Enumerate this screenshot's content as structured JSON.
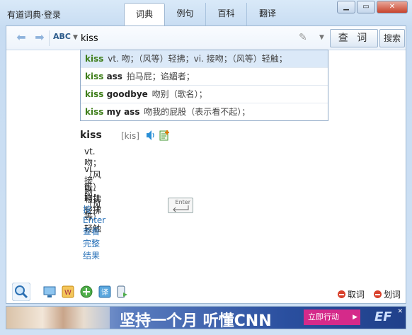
{
  "window": {
    "app_name": "有道词典",
    "separator": "·",
    "login_label": "登录",
    "minimize": "▁",
    "restore": "▭",
    "close": "✕"
  },
  "tabs": [
    {
      "label": "词典",
      "active": true
    },
    {
      "label": "例句",
      "active": false
    },
    {
      "label": "百科",
      "active": false
    },
    {
      "label": "翻译",
      "active": false
    }
  ],
  "toolbar": {
    "input_mode": "ABC",
    "search_value": "kiss",
    "lookup_button": "查 词",
    "search_button": "搜索"
  },
  "suggestions": [
    {
      "keyword": "kiss",
      "rest": "",
      "definition": "vt. 吻；（风等）轻拂；vi. 接吻；（风等）轻触；",
      "highlighted": true
    },
    {
      "keyword": "kiss",
      "rest": " ass",
      "definition": "拍马屁；谄媚者；",
      "highlighted": false
    },
    {
      "keyword": "kiss",
      "rest": " goodbye",
      "definition": "吻别（歌名）；",
      "highlighted": false
    },
    {
      "keyword": "kiss",
      "rest": " my ass",
      "definition": "吻我的屁股（表示看不起）；",
      "highlighted": false
    }
  ],
  "result": {
    "word": "kiss",
    "phonetic": "[kis]",
    "definitions": [
      "vt.吻；（风等）轻拂",
      "vi.接吻；（风等）轻触",
      "n.吻；轻拂"
    ],
    "enter_hint": "按Enter查看完整结果",
    "enter_key_label": "Enter"
  },
  "bottom": {
    "take_word": "取词",
    "select_word": "划词"
  },
  "ad": {
    "slogan": "坚持一个月  听懂CNN",
    "button": "立即行动",
    "logo": "EF"
  },
  "colors": {
    "keyword_green": "#3d7d18",
    "link_blue": "#2a72b8",
    "highlight_bg": "#dbe9f8",
    "close_red": "#c8432c"
  }
}
